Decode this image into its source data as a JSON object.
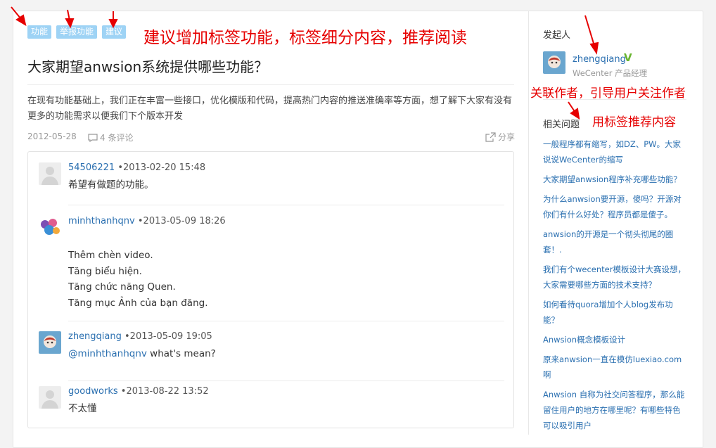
{
  "tags": [
    "功能",
    "举报功能",
    "建议"
  ],
  "annotations": {
    "tags_note": "建议增加标签功能，标签细分内容，推荐阅读",
    "author_note": "关联作者，引导用户关注作者",
    "related_note": "用标签推荐内容"
  },
  "question": {
    "title": "大家期望anwsion系统提供哪些功能？",
    "description": "在现有功能基础上，我们正在丰富一些接口，优化模版和代码，提高热门内容的推送准确率等方面，想了解下大家有没有更多的功能需求以便我们下个版本开发",
    "date": "2012-05-28",
    "comments_label": "4 条评论",
    "share_label": "分享"
  },
  "comments": [
    {
      "user": "54506221",
      "time": "•2013-02-20 15:48",
      "lines": [
        "希望有做题的功能。"
      ]
    },
    {
      "user": "minhthanhqnv",
      "time": "•2013-05-09 18:26",
      "lines": [
        "Thêm chèn video.",
        "Tăng biểu hiện.",
        "Tăng chức năng Quen.",
        "Tăng mục Ảnh của bạn đăng."
      ]
    },
    {
      "user": "zhengqiang",
      "time": "•2013-05-09 19:05",
      "mention": "@minhthanhqnv",
      "text": "what's mean?"
    },
    {
      "user": "goodworks",
      "time": "•2013-08-22 13:52",
      "lines": [
        "不太懂"
      ]
    }
  ],
  "sidebar": {
    "initiator_heading": "发起人",
    "author": {
      "name": "zhengqiang",
      "badge": "V",
      "subtitle": "WeCenter 产品经理"
    },
    "related_heading": "相关问题",
    "related": [
      "一般程序都有缩写，如DZ、PW。大家说说WeCenter的缩写",
      "大家期望anwsion程序补充哪些功能？",
      "为什么anwsion要开源，傻吗？开源对你们有什么好处？程序员都是傻子。",
      "anwsion的开源是一个彻头彻尾的圈套！.",
      "我们有个wecenter模板设计大赛设想，大家需要哪些方面的技术支持？",
      "如何看待quora增加个人blog发布功能？",
      "Anwsion概念模板设计",
      "原来anwsion一直在模仿luexiao.com啊",
      "Anwsion 自称为社交问答程序，那么能留住用户的地方在哪里呢？有哪些特色可以吸引用户"
    ]
  },
  "colors": {
    "link": "#2a6fb0",
    "tag_bg": "#9ed3f5",
    "annotation": "#e60000",
    "verified": "#6ab530"
  }
}
